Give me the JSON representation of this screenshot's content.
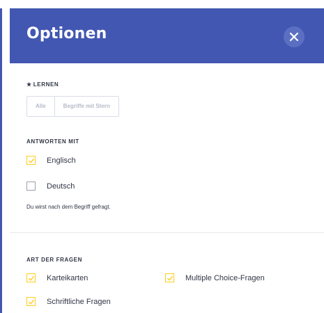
{
  "header": {
    "title": "Optionen"
  },
  "learn": {
    "label": "LERNEN",
    "segments": [
      {
        "label": "Alle"
      },
      {
        "label": "Begriffe mit Stern"
      }
    ]
  },
  "answer_with": {
    "label": "ANTWORTEN MIT",
    "options": [
      {
        "label": "Englisch",
        "checked": true
      },
      {
        "label": "Deutsch",
        "checked": false
      }
    ],
    "note": "Du wirst nach dem Begriff gefragt."
  },
  "question_types": {
    "label": "ART DER FRAGEN",
    "options": [
      {
        "label": "Karteikarten",
        "checked": true
      },
      {
        "label": "Multiple Choice-Fragen",
        "checked": true
      },
      {
        "label": "Schriftliche Fragen",
        "checked": true
      }
    ]
  },
  "colors": {
    "header": "#4257b2",
    "checkbox_checked": "#ffcd1f"
  }
}
